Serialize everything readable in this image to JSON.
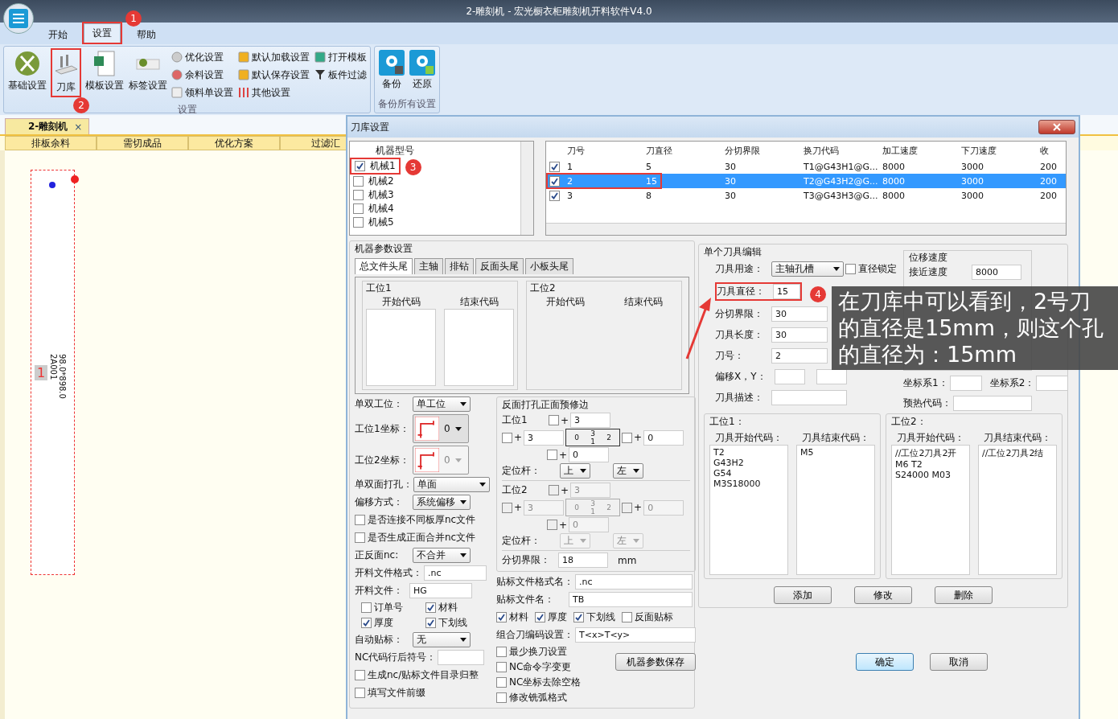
{
  "window": {
    "title": "2-雕刻机 - 宏光橱衣柜雕刻机开料软件V4.0"
  },
  "ribbon": {
    "tabs": [
      {
        "label": "开始",
        "selected": false
      },
      {
        "label": "设置",
        "selected": true,
        "badge": "1"
      },
      {
        "label": "帮助",
        "selected": false
      }
    ],
    "groups": [
      {
        "label": "设置",
        "large": [
          {
            "label": "基础设置"
          },
          {
            "label": "刀库",
            "badge": "2"
          },
          {
            "label": "模板设置"
          },
          {
            "label": "标签设置"
          }
        ],
        "small": [
          "优化设置",
          "余料设置",
          "领料单设置",
          "默认加载设置",
          "默认保存设置",
          "其他设置",
          "打开模板",
          "板件过滤"
        ]
      },
      {
        "label": "备份所有设置",
        "large": [
          {
            "label": "备份"
          },
          {
            "label": "还原"
          }
        ]
      }
    ]
  },
  "document_tab": {
    "label": "2-雕刻机",
    "close": "×"
  },
  "sub_tabs": [
    "排板余料",
    "需切成品",
    "优化方案",
    "过滤汇"
  ],
  "canvas": {
    "part_size": "98.0*898.0",
    "part_code": "2A001",
    "marker": "1"
  },
  "dialog": {
    "title": "刀库设置",
    "machine_list": {
      "header": "机器型号",
      "items": [
        {
          "label": "机械1",
          "checked": true,
          "badge": "3"
        },
        {
          "label": "机械2",
          "checked": false
        },
        {
          "label": "机械3",
          "checked": false
        },
        {
          "label": "机械4",
          "checked": false
        },
        {
          "label": "机械5",
          "checked": false
        }
      ]
    },
    "tool_table": {
      "columns": [
        "刀号",
        "刀直径",
        "分切界限",
        "换刀代码",
        "加工速度",
        "下刀速度",
        "收"
      ],
      "rows": [
        {
          "checked": true,
          "selected": false,
          "highlighted": false,
          "cells": [
            "1",
            "5",
            "30",
            "T1@G43H1@G...",
            "8000",
            "3000",
            "200"
          ]
        },
        {
          "checked": true,
          "selected": true,
          "highlighted": true,
          "cells": [
            "2",
            "15",
            "30",
            "T2@G43H2@G...",
            "8000",
            "3000",
            "200"
          ]
        },
        {
          "checked": true,
          "selected": false,
          "highlighted": false,
          "cells": [
            "3",
            "8",
            "30",
            "T3@G43H3@G...",
            "8000",
            "3000",
            "200"
          ]
        }
      ]
    },
    "machine_params": {
      "title": "机器参数设置",
      "tabs": [
        {
          "label": "总文件头尾",
          "selected": true
        },
        {
          "label": "主轴",
          "selected": false
        },
        {
          "label": "排钻",
          "selected": false
        },
        {
          "label": "反面头尾",
          "selected": false
        },
        {
          "label": "小板头尾",
          "selected": false
        }
      ],
      "stations": [
        {
          "title": "工位1",
          "start": "开始代码",
          "end": "结束代码",
          "editable": true
        },
        {
          "title": "工位2",
          "start": "开始代码",
          "end": "结束代码",
          "editable": false
        }
      ],
      "left_fields": [
        {
          "kind": "select",
          "label": "单双工位：",
          "value": "单工位"
        },
        {
          "kind": "coord",
          "label": "工位1坐标：",
          "value": "0",
          "disabled": false
        },
        {
          "kind": "coord",
          "label": "工位2坐标：",
          "value": "0",
          "disabled": true
        },
        {
          "kind": "select",
          "label": "单双面打孔：",
          "value": "单面"
        },
        {
          "kind": "select",
          "label": "偏移方式：",
          "value": "系统偏移"
        },
        {
          "kind": "checkbox",
          "label": "是否连接不同板厚nc文件",
          "checked": false
        },
        {
          "kind": "checkbox",
          "label": "是否生成正面合并nc文件",
          "checked": false
        },
        {
          "kind": "select",
          "label": "正反面nc:",
          "value": "不合并"
        },
        {
          "kind": "input",
          "label": "开料文件格式：",
          "value": ".nc"
        },
        {
          "kind": "input",
          "label": "开料文件：",
          "value": "HG"
        },
        {
          "kind": "checkgrid",
          "items": [
            {
              "label": "订单号",
              "checked": false
            },
            {
              "label": "材料",
              "checked": true
            },
            {
              "label": "厚度",
              "checked": true
            },
            {
              "label": "下划线",
              "checked": true
            }
          ]
        },
        {
          "kind": "select",
          "label": "自动贴标：",
          "value": "无"
        },
        {
          "kind": "input",
          "label": "NC代码行后符号："
        },
        {
          "kind": "checkbox",
          "label": "生成nc/贴标文件目录归整",
          "checked": false
        },
        {
          "kind": "checkbox",
          "label": "填写文件前缀",
          "checked": false
        }
      ],
      "trim": {
        "title": "反面打孔正面预修边",
        "stations": [
          {
            "label": "工位1",
            "enabled": true,
            "top": {
              "checked": false,
              "sign": "+",
              "value": "3"
            },
            "left": {
              "checked": false,
              "sign": "+",
              "value": "3"
            },
            "right": {
              "checked": false,
              "sign": "+",
              "value": "0"
            },
            "bottom": {
              "checked": false,
              "sign": "+",
              "value": "0"
            },
            "diagram": [
              "0",
              "3",
              "1",
              "2"
            ],
            "rod_label": "定位杆：",
            "rods": [
              "上",
              "左"
            ]
          },
          {
            "label": "工位2",
            "enabled": false,
            "top": {
              "checked": false,
              "sign": "+",
              "value": "3"
            },
            "left": {
              "checked": false,
              "sign": "+",
              "value": "3"
            },
            "right": {
              "checked": false,
              "sign": "+",
              "value": "0"
            },
            "bottom": {
              "checked": false,
              "sign": "+",
              "value": "0"
            },
            "diagram": [
              "0",
              "3",
              "1",
              "2"
            ],
            "rod_label": "定位杆：",
            "rods": [
              "上",
              "左"
            ]
          }
        ],
        "cut_limit": {
          "label": "分切界限：",
          "value": "18",
          "unit": "mm"
        }
      },
      "label_fields": [
        {
          "label": "贴标文件格式名：",
          "value": ".nc"
        },
        {
          "label": "贴标文件名：",
          "value": "TB"
        }
      ],
      "label_checks": [
        {
          "label": "材料",
          "checked": true
        },
        {
          "label": "厚度",
          "checked": true
        },
        {
          "label": "下划线",
          "checked": true
        },
        {
          "label": "反面贴标",
          "checked": false
        }
      ],
      "combo": {
        "label": "组合刀编码设置：",
        "value": "T<x>T<y>"
      },
      "options": [
        {
          "label": "最少换刀设置",
          "checked": false
        },
        {
          "label": "NC命令字变更",
          "checked": false
        },
        {
          "label": "NC坐标去除空格",
          "checked": false
        },
        {
          "label": "修改铣弧格式",
          "checked": false
        }
      ],
      "save_button": "机器参数保存"
    },
    "tool_edit": {
      "title": "单个刀具编辑",
      "usage": {
        "label": "刀具用途：",
        "value": "主轴孔槽"
      },
      "lock": {
        "label": "直径锁定",
        "checked": false
      },
      "fields": [
        {
          "label": "刀具直径：",
          "value": "15",
          "badge": "4"
        },
        {
          "label": "分切界限：",
          "value": "30"
        },
        {
          "label": "刀具长度：",
          "value": "30"
        },
        {
          "label": "刀号：",
          "value": "2"
        }
      ],
      "offset": {
        "label": "偏移X，Y："
      },
      "description": {
        "label": "刀具描述："
      },
      "speed": {
        "title": "位移速度",
        "label": "接近速度",
        "value": "8000"
      },
      "coords": [
        {
          "label": "坐标系1："
        },
        {
          "label": "坐标系2："
        }
      ],
      "preheat": {
        "label": "预热代码："
      },
      "stations": [
        {
          "title": "工位1：",
          "start_label": "刀具开始代码：",
          "end_label": "刀具结束代码：",
          "start": [
            "T2",
            "G43H2",
            "G54",
            "M3S18000"
          ],
          "end": [
            "M5"
          ]
        },
        {
          "title": "工位2：",
          "start_label": "刀具开始代码：",
          "end_label": "刀具结束代码：",
          "start": [
            "//工位2刀具2开",
            "M6 T2",
            "S24000 M03"
          ],
          "end": [
            "//工位2刀具2结"
          ]
        }
      ],
      "buttons": [
        "添加",
        "修改",
        "删除"
      ]
    },
    "buttons": [
      {
        "label": "确定",
        "default": true
      },
      {
        "label": "取消",
        "default": false
      }
    ]
  },
  "annotations": {
    "note": "在刀库中可以看到，2号刀的直径是15mm，则这个孔的直径为：15mm"
  }
}
